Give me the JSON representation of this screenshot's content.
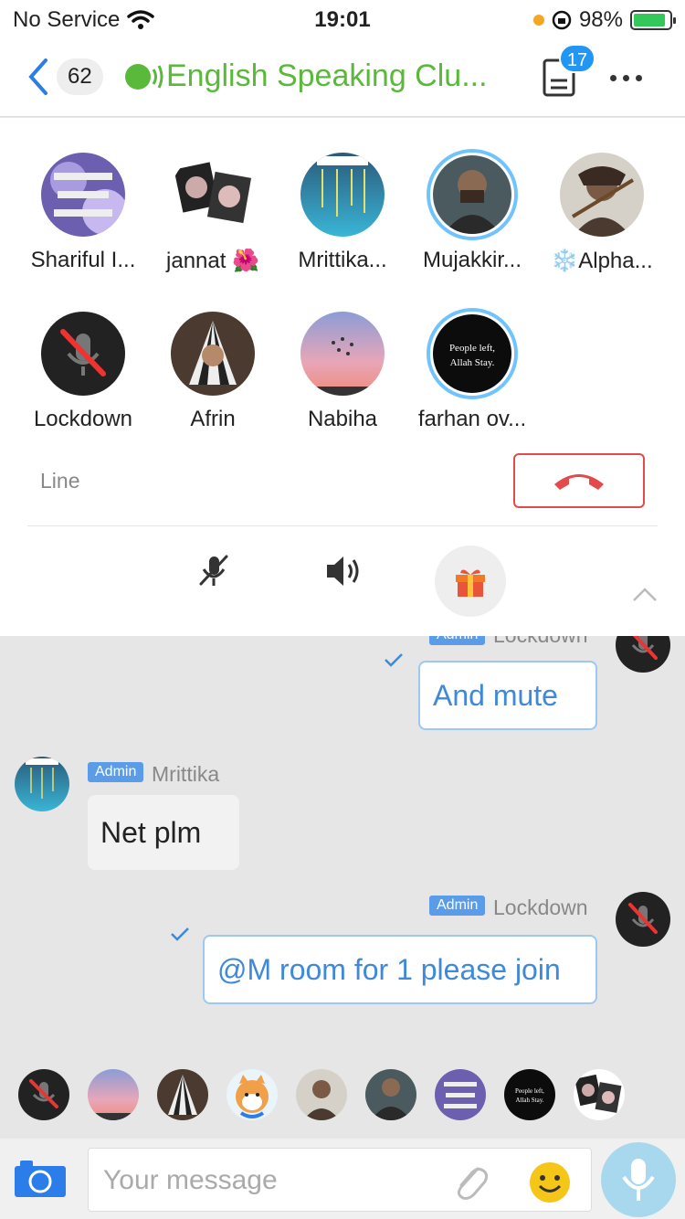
{
  "status_bar": {
    "carrier": "No Service",
    "time": "19:01",
    "battery": "98%"
  },
  "header": {
    "back_count": "62",
    "title": "English Speaking Clu...",
    "doc_badge": "17"
  },
  "voice": {
    "members": [
      {
        "name": "Shariful I...",
        "icon": "avatar-purple-text"
      },
      {
        "name": "jannat 🌺",
        "icon": "avatar-collage"
      },
      {
        "name": "Mrittika...",
        "icon": "avatar-teal-text"
      },
      {
        "name": "Mujakkir...",
        "icon": "avatar-warrior",
        "speaking": true
      },
      {
        "name": "❄️Alpha...",
        "icon": "avatar-archer"
      },
      {
        "name": "Lockdown",
        "icon": "muted-mic-avatar"
      },
      {
        "name": "Afrin",
        "icon": "avatar-hijab"
      },
      {
        "name": "Nabiha",
        "icon": "avatar-sunset-birds"
      },
      {
        "name": "farhan ov...",
        "icon": "avatar-black-quote",
        "speaking": true
      }
    ],
    "line_label": "Line",
    "quote_text": "People left, Allah Stay."
  },
  "chat": {
    "messages": [
      {
        "sender": "Lockdown",
        "admin": "Admin",
        "text": "And mute",
        "outgoing": true
      },
      {
        "sender": "Mrittika",
        "admin": "Admin",
        "text": "Net plm",
        "outgoing": false
      },
      {
        "sender": "Lockdown",
        "admin": "Admin",
        "text": "@M room for 1 please join",
        "outgoing": true
      }
    ]
  },
  "input": {
    "placeholder": "Your message"
  },
  "colors": {
    "accent_green": "#5ab93a",
    "accent_blue": "#2196f3",
    "hangup_red": "#e34a4a"
  }
}
